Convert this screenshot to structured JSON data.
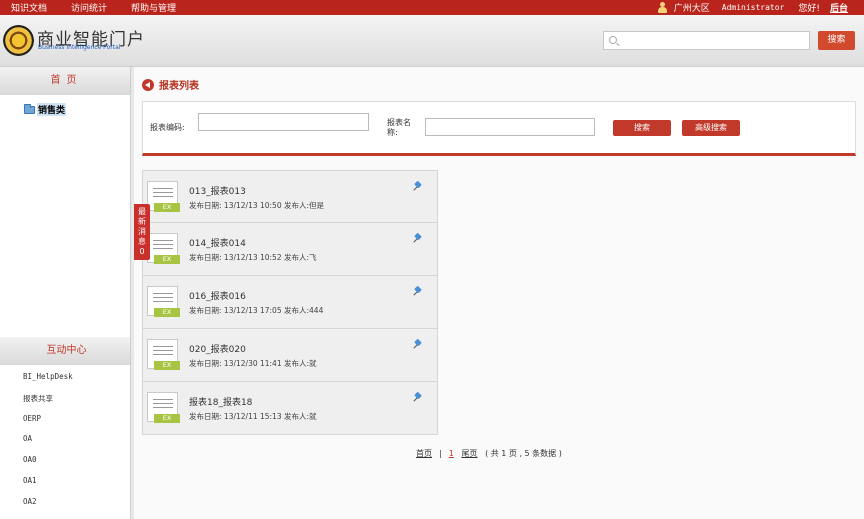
{
  "topbar": {
    "nav": [
      "知识文档",
      "访问统计",
      "帮助与管理"
    ],
    "region": "广州大区",
    "user": "Administrator",
    "greeting": "您好!",
    "backend": "后台"
  },
  "header": {
    "title": "商业智能门户",
    "subtitle": "Business Intelligence Portal",
    "search_placeholder": "",
    "search_button": "搜索"
  },
  "sidebar": {
    "home": "首页",
    "tree_item": "销售类",
    "interact": "互动中心",
    "links": [
      "BI_HelpDesk",
      "报表共享",
      "OERP",
      "OA",
      "OA0",
      "OA1",
      "OA2"
    ]
  },
  "news_tab": {
    "label": "最新消息",
    "count": "0"
  },
  "main": {
    "section_title": "报表列表",
    "search": {
      "code_label": "报表编码:",
      "code_value": "",
      "name_label_1": "报表名",
      "name_label_2": "称:",
      "name_value": "",
      "search_button": "搜索",
      "advanced_button": "高级搜索"
    },
    "reports": [
      {
        "name": "013_报表013",
        "date_label": "发布日期:",
        "date": "13/12/13 10:50",
        "publisher_label": "发布人:",
        "publisher": "但是",
        "badge": "EX"
      },
      {
        "name": "014_报表014",
        "date_label": "发布日期:",
        "date": "13/12/13 10:52",
        "publisher_label": "发布人:",
        "publisher": "飞",
        "badge": "EX"
      },
      {
        "name": "016_报表016",
        "date_label": "发布日期:",
        "date": "13/12/13 17:05",
        "publisher_label": "发布人:",
        "publisher": "444",
        "badge": "EX"
      },
      {
        "name": "020_报表020",
        "date_label": "发布日期:",
        "date": "13/12/30 11:41",
        "publisher_label": "发布人:",
        "publisher": "就",
        "badge": "EX"
      },
      {
        "name": "报表18_报表18",
        "date_label": "发布日期:",
        "date": "13/12/11 15:13",
        "publisher_label": "发布人:",
        "publisher": "就",
        "badge": "EX"
      }
    ],
    "pager": {
      "first": "首页",
      "current": "1",
      "last": "尾页",
      "summary": "( 共 1 页 , 5 条数据 )"
    }
  }
}
